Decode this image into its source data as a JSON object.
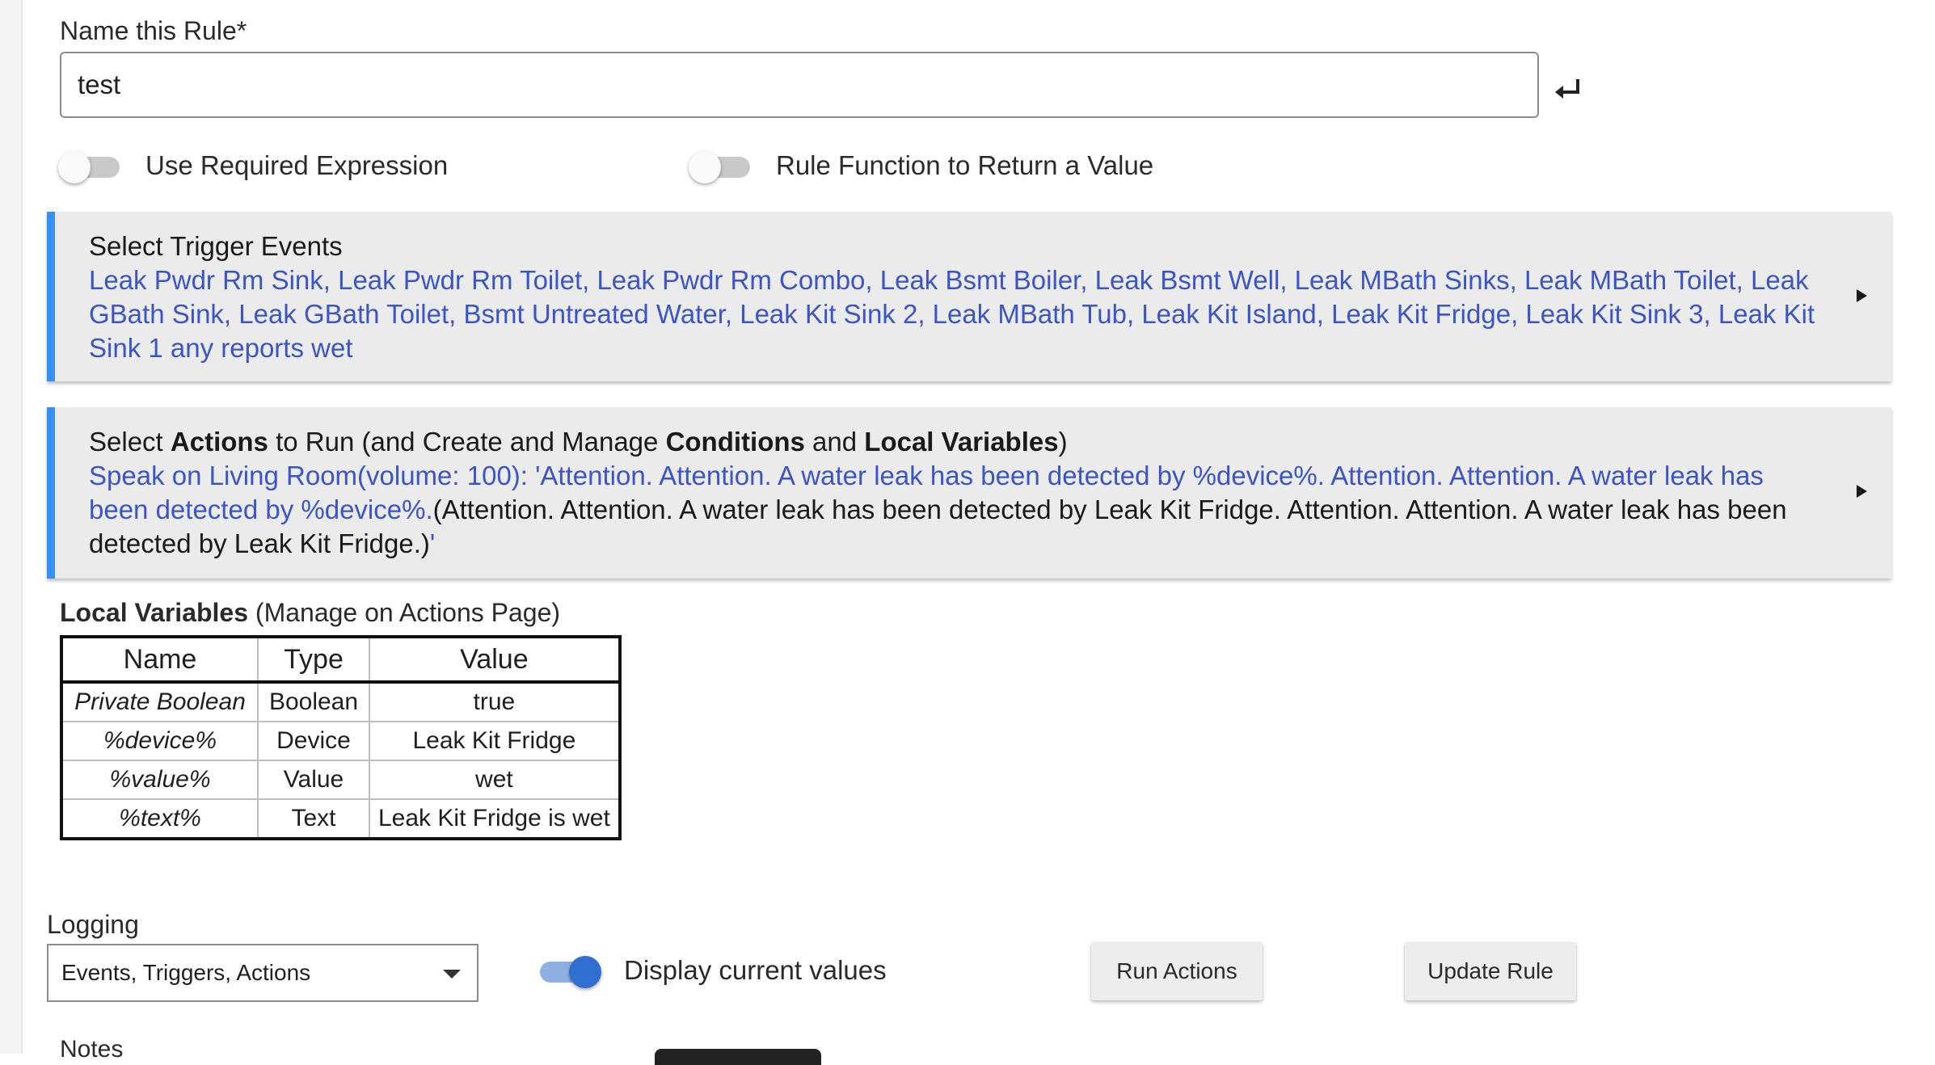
{
  "rule_name": {
    "label": "Name this Rule*",
    "value": "test"
  },
  "toggles": {
    "required_expression": {
      "label": "Use Required Expression",
      "on": false
    },
    "return_value": {
      "label": "Rule Function to Return a Value",
      "on": false
    }
  },
  "triggers": {
    "title": "Select Trigger Events",
    "summary": "Leak Pwdr Rm Sink, Leak Pwdr Rm Toilet, Leak Pwdr Rm Combo, Leak Bsmt Boiler, Leak Bsmt Well, Leak MBath Sinks, Leak MBath Toilet, Leak GBath Sink, Leak GBath Toilet, Bsmt Untreated Water, Leak Kit Sink 2, Leak MBath Tub, Leak Kit Island, Leak Kit Fridge, Leak Kit Sink 3, Leak Kit Sink 1 any reports wet"
  },
  "actions": {
    "title_pre": "Select ",
    "title_b1": "Actions",
    "title_mid1": " to Run (and Create and Manage ",
    "title_b2": "Conditions",
    "title_mid2": " and ",
    "title_b3": "Local Variables",
    "title_post": ")",
    "link_text": "Speak on Living Room(volume: 100): 'Attention.  Attention.  A water leak has been detected by %device%. Attention.  Attention.  A water leak has been detected by %device%.",
    "resolved_text": "(Attention.  Attention.  A water leak has been detected by Leak Kit Fridge. Attention.  Attention.  A water leak has been detected by Leak Kit Fridge.)",
    "closing_quote": "'"
  },
  "local_vars": {
    "title_bold": "Local Variables",
    "title_rest": " (Manage on Actions Page)",
    "headers": [
      "Name",
      "Type",
      "Value"
    ],
    "rows": [
      {
        "name": "Private Boolean",
        "type": "Boolean",
        "value": "true"
      },
      {
        "name": "%device%",
        "type": "Device",
        "value": "Leak Kit Fridge"
      },
      {
        "name": "%value%",
        "type": "Value",
        "value": "wet"
      },
      {
        "name": "%text%",
        "type": "Text",
        "value": "Leak Kit Fridge is wet"
      }
    ]
  },
  "logging": {
    "label": "Logging",
    "selected": "Events, Triggers, Actions"
  },
  "display_current": {
    "label": "Display current values",
    "on": true
  },
  "buttons": {
    "run_actions": "Run Actions",
    "update_rule": "Update Rule"
  },
  "notes_label": "Notes",
  "colors": {
    "accent": "#3b8ff0",
    "link": "#3b55c8",
    "toggle_on": "#2f6fd0"
  }
}
